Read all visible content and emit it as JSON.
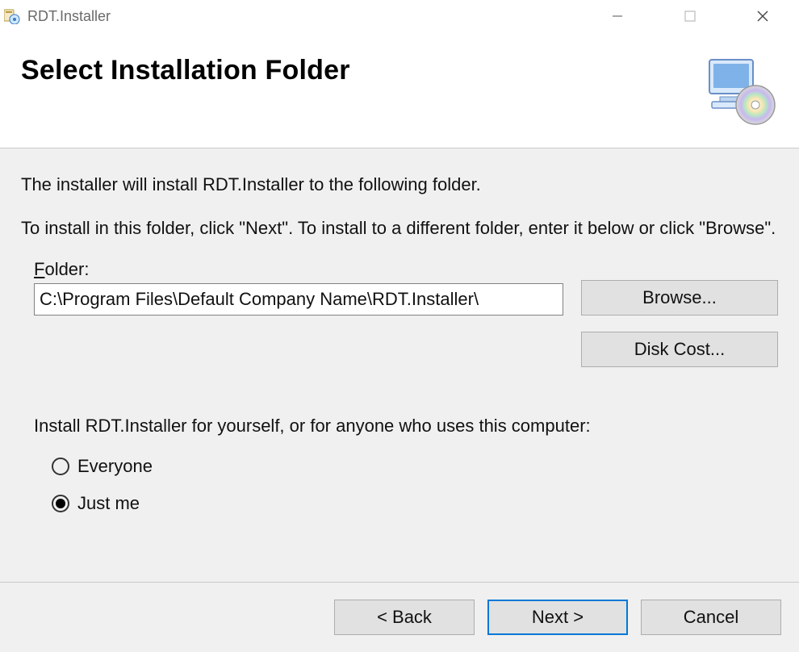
{
  "window": {
    "title": "RDT.Installer"
  },
  "header": {
    "title": "Select Installation Folder"
  },
  "content": {
    "intro": "The installer will install RDT.Installer to the following folder.",
    "instruction": "To install in this folder, click \"Next\". To install to a different folder, enter it below or click \"Browse\".",
    "folder_label_pre": "F",
    "folder_label_post": "older:",
    "folder_value": "C:\\Program Files\\Default Company Name\\RDT.Installer\\",
    "browse_label": "Browse...",
    "diskcost_label": "Disk Cost...",
    "install_for_label": "Install RDT.Installer for yourself, or for anyone who uses this computer:",
    "radio_everyone": "Everyone",
    "radio_justme": "Just me",
    "selected": "justme"
  },
  "footer": {
    "back_label": "< Back",
    "next_label": "Next >",
    "cancel_label": "Cancel"
  }
}
